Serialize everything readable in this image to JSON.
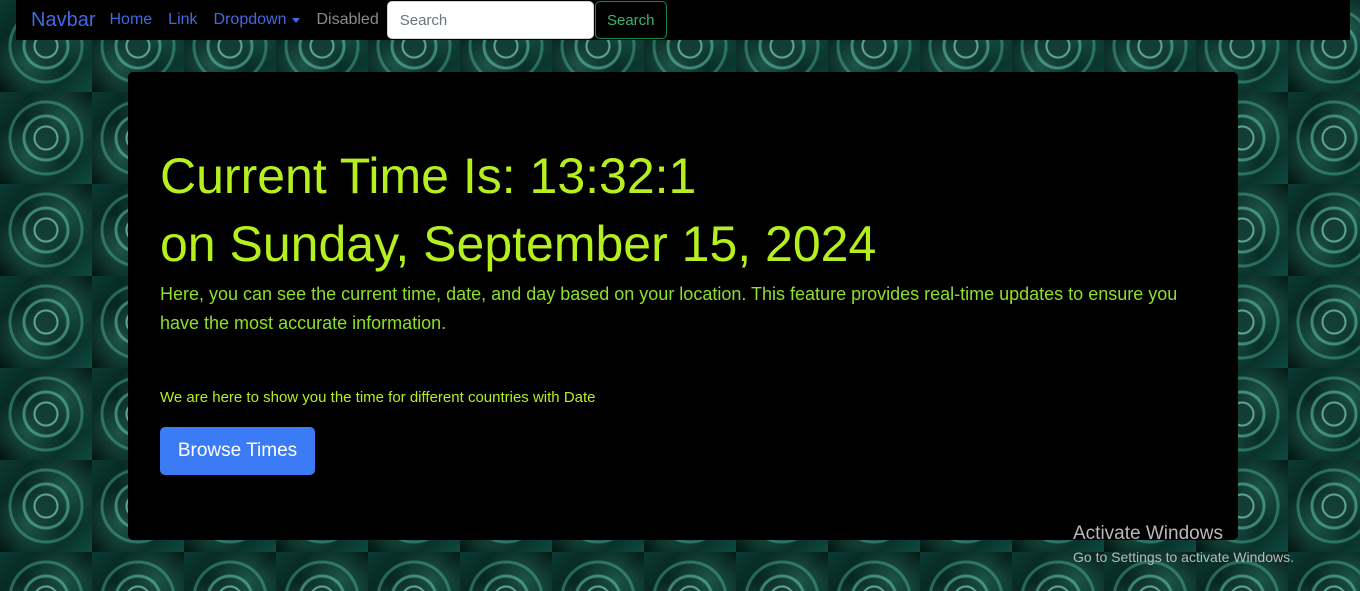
{
  "navbar": {
    "brand": "Navbar",
    "links": {
      "home": "Home",
      "link": "Link",
      "dropdown": "Dropdown",
      "disabled": "Disabled"
    },
    "search": {
      "placeholder": "Search",
      "button_label": "Search"
    }
  },
  "main": {
    "time_line": "Current Time Is: 13:32:1",
    "date_line": "on Sunday, September 15, 2024",
    "description": "Here, you can see the current time, date, and day based on your location. This feature provides real-time updates to ensure you have the most accurate information.",
    "subtext": "We are here to show you the time for different countries with Date",
    "browse_button": "Browse Times"
  },
  "watermark": {
    "title": "Activate Windows",
    "subtitle": "Go to Settings to activate Windows."
  },
  "colors": {
    "brand_link": "#4169e1",
    "headline": "#b5f01e",
    "description": "#8de02a",
    "primary_button": "#3b7bf5",
    "search_button": "#198754"
  },
  "icons": {
    "dropdown": "chevron-down-icon"
  }
}
